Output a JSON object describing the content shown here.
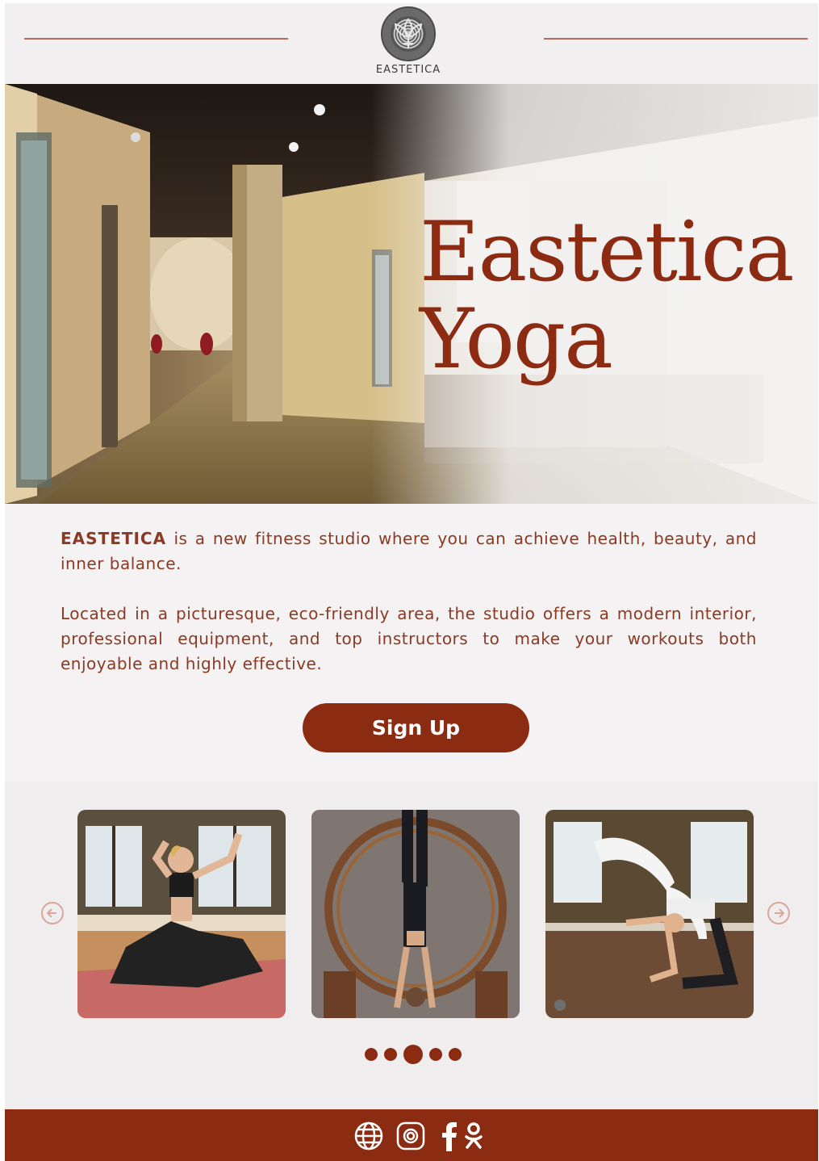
{
  "header": {
    "brand": "EASTETICA",
    "logo_icon": "lotus-logo-icon"
  },
  "hero": {
    "title_line1": "Eastetica",
    "title_line2": "Yoga",
    "title_color": "#8d2a12"
  },
  "intro": {
    "brand_bold": "EASTETICA",
    "p1_rest": " is a new fitness studio where you can achieve health, beauty, and inner balance.",
    "p2": "Located in a picturesque, eco-friendly area, the studio offers a modern interior, professional equipment, and top instructors to make your workouts both enjoyable and highly effective."
  },
  "cta": {
    "signup_label": "Sign Up"
  },
  "gallery": {
    "prev_icon": "arrow-left-circle-icon",
    "next_icon": "arrow-right-circle-icon",
    "slides": [
      "yoga pose on mat",
      "aerial handstand in wooden hoop",
      "partner backbend in studio"
    ],
    "dots_count": 5,
    "active_dot": 3
  },
  "footer": {
    "icons": [
      "globe-icon",
      "instagram-icon",
      "facebook-icon",
      "odnoklassniki-icon"
    ]
  },
  "colors": {
    "accent": "#8a2b12",
    "text": "#8a3a24",
    "background": "#f4f2f2"
  }
}
